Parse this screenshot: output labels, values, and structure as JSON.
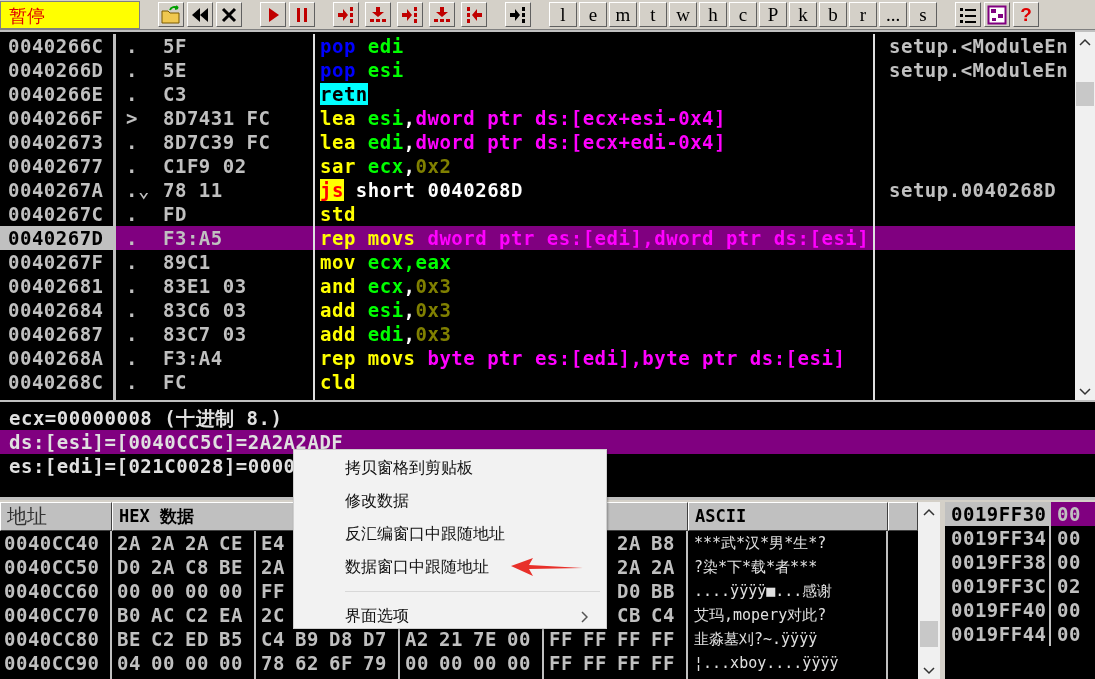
{
  "toolbar": {
    "status": "暂停",
    "button_groups": [
      [
        {
          "kind": "open"
        },
        {
          "kind": "rewind"
        },
        {
          "kind": "close"
        }
      ],
      [
        {
          "kind": "run"
        },
        {
          "kind": "pause"
        }
      ],
      [
        {
          "kind": "step-into"
        },
        {
          "kind": "step-over"
        },
        {
          "kind": "trace-into"
        },
        {
          "kind": "trace-over"
        },
        {
          "kind": "execute-till-return"
        }
      ],
      [
        {
          "kind": "go-to"
        }
      ],
      [
        {
          "kind": "window",
          "label": "l"
        },
        {
          "kind": "window",
          "label": "e"
        },
        {
          "kind": "window",
          "label": "m"
        },
        {
          "kind": "window",
          "label": "t"
        },
        {
          "kind": "window",
          "label": "w"
        },
        {
          "kind": "window",
          "label": "h"
        },
        {
          "kind": "window",
          "label": "c"
        },
        {
          "kind": "window",
          "label": "P"
        },
        {
          "kind": "window",
          "label": "k"
        },
        {
          "kind": "window",
          "label": "b"
        },
        {
          "kind": "window",
          "label": "r"
        },
        {
          "kind": "window",
          "label": "..."
        },
        {
          "kind": "window",
          "label": "s"
        }
      ],
      [
        {
          "kind": "list"
        },
        {
          "kind": "grid"
        },
        {
          "kind": "help",
          "label": "?"
        }
      ]
    ]
  },
  "disassembly": {
    "rows": [
      {
        "address": "0040266C",
        "mark": ".",
        "hex": "5F",
        "selected": false,
        "instruction": [
          {
            "text": "pop ",
            "kind": "stack"
          },
          {
            "text": "edi",
            "kind": "register"
          }
        ],
        "comment": "setup.<ModuleEn"
      },
      {
        "address": "0040266D",
        "mark": ".",
        "hex": "5E",
        "selected": false,
        "instruction": [
          {
            "text": "pop ",
            "kind": "stack"
          },
          {
            "text": "esi",
            "kind": "register"
          }
        ],
        "comment": "setup.<ModuleEn"
      },
      {
        "address": "0040266E",
        "mark": ".",
        "hex": "C3",
        "selected": false,
        "instruction": [
          {
            "text": "retn",
            "kind": "return"
          }
        ]
      },
      {
        "address": "0040266F",
        "mark": ">",
        "hex": "8D7431 FC",
        "selected": false,
        "instruction": [
          {
            "text": "lea ",
            "kind": "op"
          },
          {
            "text": "esi",
            "kind": "register"
          },
          {
            "text": ",",
            "kind": "plain"
          },
          {
            "text": "dword ptr ds:[ecx+esi-0x4]",
            "kind": "memory"
          }
        ]
      },
      {
        "address": "00402673",
        "mark": ".",
        "hex": "8D7C39 FC",
        "selected": false,
        "instruction": [
          {
            "text": "lea ",
            "kind": "op"
          },
          {
            "text": "edi",
            "kind": "register"
          },
          {
            "text": ",",
            "kind": "plain"
          },
          {
            "text": "dword ptr ds:[ecx+edi-0x4]",
            "kind": "memory"
          }
        ]
      },
      {
        "address": "00402677",
        "mark": ".",
        "hex": "C1F9 02",
        "selected": false,
        "instruction": [
          {
            "text": "sar ",
            "kind": "op"
          },
          {
            "text": "ecx",
            "kind": "register"
          },
          {
            "text": ",",
            "kind": "plain"
          },
          {
            "text": "0x2",
            "kind": "constant"
          }
        ]
      },
      {
        "address": "0040267A",
        "mark": ".⌄",
        "hex": "78 11",
        "selected": false,
        "instruction": [
          {
            "text": "js",
            "kind": "jump"
          },
          {
            "text": " short 0040268D",
            "kind": "plain"
          }
        ],
        "comment": "setup.0040268D"
      },
      {
        "address": "0040267C",
        "mark": ".",
        "hex": "FD",
        "selected": false,
        "instruction": [
          {
            "text": "std",
            "kind": "op"
          }
        ]
      },
      {
        "address": "0040267D",
        "mark": ".",
        "hex": "F3:A5",
        "selected": true,
        "instruction": [
          {
            "text": "rep movs ",
            "kind": "op"
          },
          {
            "text": "dword ptr es:[edi],dword ptr ds:[esi]",
            "kind": "memory"
          }
        ]
      },
      {
        "address": "0040267F",
        "mark": ".",
        "hex": "89C1",
        "selected": false,
        "instruction": [
          {
            "text": "mov ",
            "kind": "op"
          },
          {
            "text": "ecx,eax",
            "kind": "register"
          }
        ]
      },
      {
        "address": "00402681",
        "mark": ".",
        "hex": "83E1 03",
        "selected": false,
        "instruction": [
          {
            "text": "and ",
            "kind": "op"
          },
          {
            "text": "ecx",
            "kind": "register"
          },
          {
            "text": ",",
            "kind": "plain"
          },
          {
            "text": "0x3",
            "kind": "constant"
          }
        ]
      },
      {
        "address": "00402684",
        "mark": ".",
        "hex": "83C6 03",
        "selected": false,
        "instruction": [
          {
            "text": "add ",
            "kind": "op"
          },
          {
            "text": "esi",
            "kind": "register"
          },
          {
            "text": ",",
            "kind": "plain"
          },
          {
            "text": "0x3",
            "kind": "constant"
          }
        ]
      },
      {
        "address": "00402687",
        "mark": ".",
        "hex": "83C7 03",
        "selected": false,
        "instruction": [
          {
            "text": "add ",
            "kind": "op"
          },
          {
            "text": "edi",
            "kind": "register"
          },
          {
            "text": ",",
            "kind": "plain"
          },
          {
            "text": "0x3",
            "kind": "constant"
          }
        ]
      },
      {
        "address": "0040268A",
        "mark": ".",
        "hex": "F3:A4",
        "selected": false,
        "instruction": [
          {
            "text": "rep movs ",
            "kind": "op"
          },
          {
            "text": "byte ptr es:[edi],byte ptr ds:[esi]",
            "kind": "memory"
          }
        ]
      },
      {
        "address": "0040268C",
        "mark": ".",
        "hex": "FC",
        "selected": false,
        "instruction": [
          {
            "text": "cld",
            "kind": "op"
          }
        ]
      }
    ]
  },
  "info": {
    "lines": [
      {
        "text": "ecx=00000008 (十进制 8.)",
        "selected": false
      },
      {
        "text": "ds:[esi]=[0040CC5C]=2A2A2ADF",
        "selected": true
      },
      {
        "text": "es:[edi]=[021C0028]=0000",
        "selected": false
      }
    ]
  },
  "dump": {
    "columns": [
      "地址",
      "HEX 数据",
      "ASCII"
    ],
    "rows": [
      {
        "address": "0040CC40",
        "bytes": [
          "2A",
          "2A",
          "2A",
          "CE",
          "E4"
        ],
        "bytes_tail": [
          "2A",
          "B8"
        ],
        "ascii": "***武*汉*男*生*?"
      },
      {
        "address": "0040CC50",
        "bytes": [
          "D0",
          "2A",
          "C8",
          "BE",
          "2A"
        ],
        "bytes_tail": [
          "2A",
          "2A"
        ],
        "ascii": "?染*下*载*者***"
      },
      {
        "address": "0040CC60",
        "bytes": [
          "00",
          "00",
          "00",
          "00",
          "FF"
        ],
        "bytes_tail": [
          "D0",
          "BB"
        ],
        "ascii": "....ÿÿÿÿ■...感谢"
      },
      {
        "address": "0040CC70",
        "bytes": [
          "B0",
          "AC",
          "C2",
          "EA",
          "2C"
        ],
        "bytes_tail": [
          "CB",
          "C4"
        ],
        "ascii": "艾玛,mopery对此?"
      },
      {
        "address": "0040CC80",
        "bytes": [
          "BE",
          "C2",
          "ED",
          "B5",
          "C4",
          "B9",
          "D8",
          "D7",
          "A2",
          "21",
          "7E",
          "00",
          "FF",
          "FF",
          "FF",
          "FF"
        ],
        "ascii": "韭淼墓刈?~.ÿÿÿÿ"
      },
      {
        "address": "0040CC90",
        "bytes": [
          "04",
          "00",
          "00",
          "00",
          "78",
          "62",
          "6F",
          "79",
          "00",
          "00",
          "00",
          "00",
          "FF",
          "FF",
          "FF",
          "FF"
        ],
        "ascii": "¦...xboy....ÿÿÿÿ"
      }
    ]
  },
  "stack": {
    "rows": [
      {
        "address": "0019FF30",
        "value": "00",
        "selected": true
      },
      {
        "address": "0019FF34",
        "value": "00",
        "selected": false
      },
      {
        "address": "0019FF38",
        "value": "00",
        "selected": false
      },
      {
        "address": "0019FF3C",
        "value": "02",
        "selected": false
      },
      {
        "address": "0019FF40",
        "value": "00",
        "selected": false
      },
      {
        "address": "0019FF44",
        "value": "00",
        "selected": false
      }
    ]
  },
  "context_menu": {
    "items": [
      {
        "kind": "item",
        "label": "拷贝窗格到剪贴板",
        "has_submenu": false
      },
      {
        "kind": "item",
        "label": "修改数据",
        "has_submenu": false
      },
      {
        "kind": "item",
        "label": "反汇编窗口中跟随地址",
        "has_submenu": false
      },
      {
        "kind": "item",
        "label": "数据窗口中跟随地址",
        "has_submenu": false
      },
      {
        "kind": "separator"
      },
      {
        "kind": "item",
        "label": "界面选项",
        "has_submenu": true
      }
    ]
  }
}
